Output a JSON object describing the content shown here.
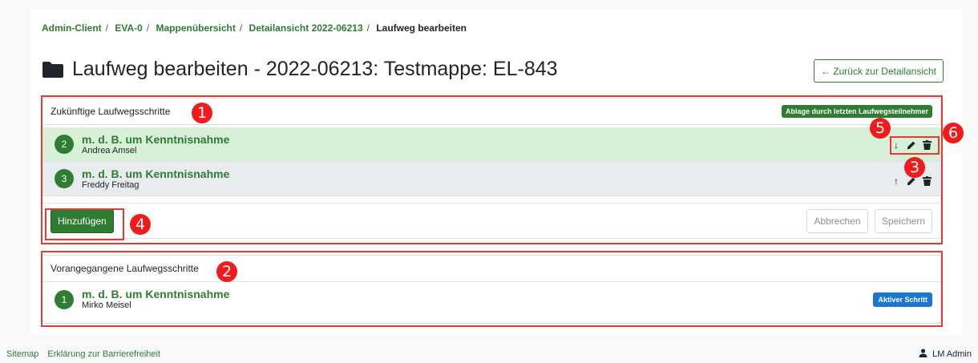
{
  "breadcrumb": [
    "Admin-Client",
    "EVA-0",
    "Mappenübersicht",
    "Detailansicht 2022-06213",
    "Laufweg bearbeiten"
  ],
  "page_title": "Laufweg bearbeiten - 2022-06213: Testmappe: EL-843",
  "back_button": "← Zurück zur Detailansicht",
  "future_card": {
    "title": "Zukünftige Laufwegsschritte",
    "badge": "Ablage durch letzten Laufwegsteilnehmer",
    "steps": [
      {
        "num": "2",
        "title": "m. d. B. um Kenntnisnahme",
        "name": "Andrea Amsel"
      },
      {
        "num": "3",
        "title": "m. d. B. um Kenntnisnahme",
        "name": "Freddy Freitag"
      }
    ],
    "add_button": "Hinzufügen",
    "cancel_button": "Abbrechen",
    "save_button": "Speichern"
  },
  "past_card": {
    "title": "Vorangegangene Laufwegsschritte",
    "steps": [
      {
        "num": "1",
        "title": "m. d. B. um Kenntnisnahme",
        "name": "Mirko Meisel",
        "badge": "Aktiver Schritt"
      }
    ]
  },
  "markers": [
    "1",
    "2",
    "3",
    "4",
    "5",
    "6"
  ],
  "footer": {
    "links": [
      "Sitemap",
      "Erklärung zur Barrierefreiheit"
    ],
    "user": "LM Admin"
  },
  "colors": {
    "accent": "#2e7d32",
    "annotation": "#f21b1b",
    "active_badge": "#1976d2"
  }
}
